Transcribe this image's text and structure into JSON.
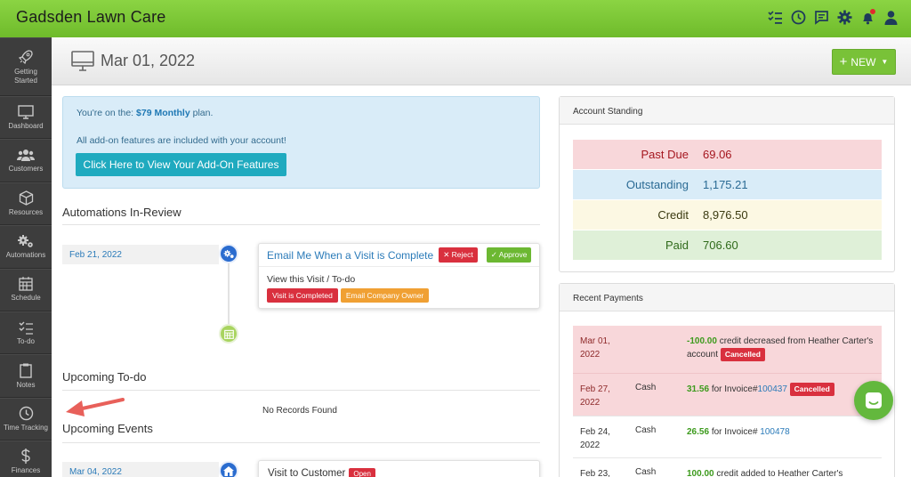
{
  "app": {
    "title": "Gadsden Lawn Care"
  },
  "topbar": {
    "icons": [
      "checklist-icon",
      "clock-icon",
      "chat-icon",
      "gear-icon",
      "bell-icon",
      "user-icon"
    ],
    "notification_color": "#e0282e"
  },
  "sidebar": {
    "items": [
      {
        "label": "Getting Started",
        "icon": "rocket-icon"
      },
      {
        "label": "Dashboard",
        "icon": "monitor-icon"
      },
      {
        "label": "Customers",
        "icon": "users-icon"
      },
      {
        "label": "Resources",
        "icon": "cube-icon"
      },
      {
        "label": "Automations",
        "icon": "gears-icon"
      },
      {
        "label": "Schedule",
        "icon": "calendar-icon"
      },
      {
        "label": "To-do",
        "icon": "checklist-icon"
      },
      {
        "label": "Notes",
        "icon": "clipboard-icon"
      },
      {
        "label": "Time Tracking",
        "icon": "clock-icon"
      },
      {
        "label": "Finances",
        "icon": "dollar-icon"
      }
    ]
  },
  "header": {
    "date": "Mar 01, 2022",
    "new_label": "NEW"
  },
  "plan": {
    "prefix": "You're on the:",
    "plan_name": "$79 Monthly",
    "suffix": "plan.",
    "addons_text": "All add-on features are included with your account!",
    "addons_button": "Click Here to View Your Add-On Features"
  },
  "automations": {
    "title": "Automations In-Review",
    "item": {
      "date": "Feb 21, 2022",
      "name": "Email Me When a Visit is Complete",
      "reject_label": "Reject",
      "approve_label": "Approve",
      "body": "View this Visit / To-do",
      "tag1": "Visit is Completed",
      "tag2": "Email Company Owner"
    }
  },
  "todo": {
    "title": "Upcoming To-do",
    "empty_text": "No Records Found"
  },
  "events": {
    "title": "Upcoming Events",
    "item": {
      "date": "Mar 04, 2022",
      "name": "Visit to Customer",
      "status": "Open"
    }
  },
  "standing": {
    "title": "Account Standing",
    "rows": [
      {
        "label": "Past Due",
        "value": "69.06",
        "bg": "#f8d7da",
        "color": "#a5161f"
      },
      {
        "label": "Outstanding",
        "value": "1,175.21",
        "bg": "#d9ecf8",
        "color": "#2a6a94"
      },
      {
        "label": "Credit",
        "value": "8,976.50",
        "bg": "#fcf8e3",
        "color": "#3a3a10"
      },
      {
        "label": "Paid",
        "value": "706.60",
        "bg": "#dff0d8",
        "color": "#2f6a1a"
      }
    ]
  },
  "payments": {
    "title": "Recent Payments",
    "rows": [
      {
        "date": "Mar 01, 2022",
        "method": "",
        "amount": "-100.00",
        "text": "credit decreased from Heather Carter's account",
        "link": "",
        "status": "Cancelled"
      },
      {
        "date": "Feb 27, 2022",
        "method": "Cash",
        "amount": "31.56",
        "text": "for Invoice#",
        "link": "100437",
        "status": "Cancelled"
      },
      {
        "date": "Feb 24, 2022",
        "method": "Cash",
        "amount": "26.56",
        "text": "for Invoice#",
        "link": "100478",
        "status": ""
      },
      {
        "date": "Feb 23,",
        "method": "Cash",
        "amount": "100.00",
        "text": "credit added to Heather Carter's",
        "link": "",
        "status": ""
      }
    ]
  }
}
